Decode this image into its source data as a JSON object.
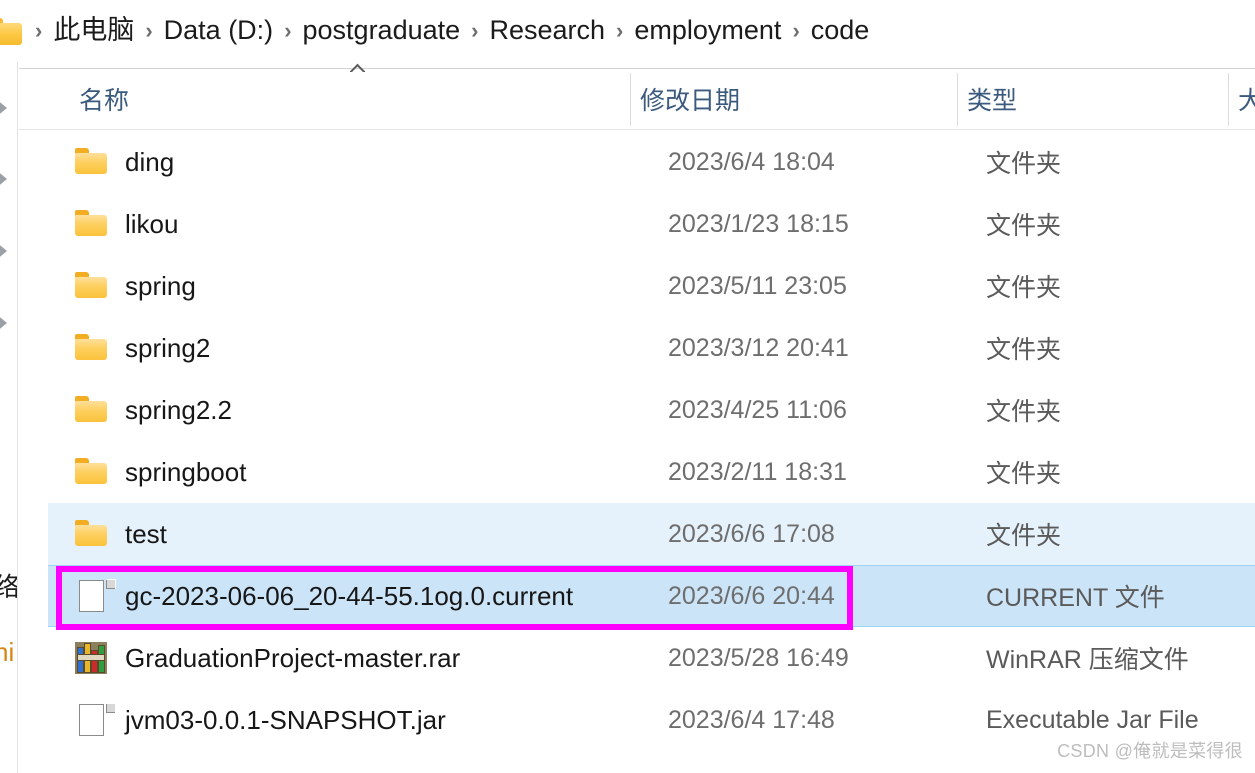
{
  "window": {
    "type": "file-explorer"
  },
  "addressbar": {
    "folder_icon": "folder-icon",
    "separator": "›",
    "crumbs": [
      "此电脑",
      "Data (D:)",
      "postgraduate",
      "Research",
      "employment",
      "code"
    ]
  },
  "navpane": {
    "fragments": [
      {
        "text": "络",
        "orange": false
      },
      {
        "text": "ni",
        "orange": true
      }
    ]
  },
  "columns": {
    "name": "名称",
    "date_modified": "修改日期",
    "type": "类型",
    "size": "大",
    "sort_indicator": "ascending-caret-icon"
  },
  "files": [
    {
      "name": "ding",
      "date": "2023/6/4 18:04",
      "type": "文件夹",
      "icon": "folder-icon",
      "state": "normal"
    },
    {
      "name": "likou",
      "date": "2023/1/23 18:15",
      "type": "文件夹",
      "icon": "folder-icon",
      "state": "normal"
    },
    {
      "name": "spring",
      "date": "2023/5/11 23:05",
      "type": "文件夹",
      "icon": "folder-icon",
      "state": "normal"
    },
    {
      "name": "spring2",
      "date": "2023/3/12 20:41",
      "type": "文件夹",
      "icon": "folder-icon",
      "state": "normal"
    },
    {
      "name": "spring2.2",
      "date": "2023/4/25 11:06",
      "type": "文件夹",
      "icon": "folder-icon",
      "state": "normal"
    },
    {
      "name": "springboot",
      "date": "2023/2/11 18:31",
      "type": "文件夹",
      "icon": "folder-icon",
      "state": "normal"
    },
    {
      "name": "test",
      "date": "2023/6/6 17:08",
      "type": "文件夹",
      "icon": "folder-icon",
      "state": "hover"
    },
    {
      "name": "gc-2023-06-06_20-44-55.1og.0.current",
      "date": "2023/6/6 20:44",
      "type": "CURRENT 文件",
      "icon": "file-icon",
      "state": "selected"
    },
    {
      "name": "GraduationProject-master.rar",
      "date": "2023/5/28 16:49",
      "type": "WinRAR 压缩文件",
      "icon": "winrar-icon",
      "state": "normal"
    },
    {
      "name": "jvm03-0.0.1-SNAPSHOT.jar",
      "date": "2023/6/4 17:48",
      "type": "Executable Jar File",
      "icon": "file-icon",
      "state": "normal"
    }
  ],
  "annotation": {
    "color": "#ff00ff",
    "target": "gc-2023-06-06_20-44-55.1og.0.current"
  },
  "watermark": {
    "text": "CSDN @俺就是菜得很"
  }
}
